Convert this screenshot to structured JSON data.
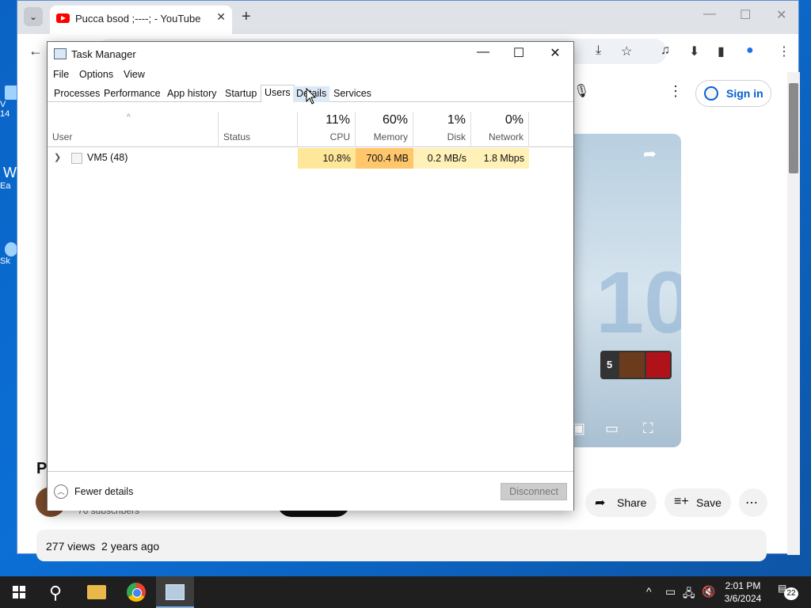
{
  "browser": {
    "tab_title": "Pucca bsod ;----; - YouTube",
    "signin_label": "Sign in",
    "views": "277 views",
    "age": "2 years ago",
    "subscribers": "76 subscribers",
    "share_label": "Share",
    "save_label": "Save",
    "page_title_fragment": "P",
    "playlist_count": "5"
  },
  "desktop": {
    "icons": [
      "V",
      "14",
      "W",
      "Ea",
      "Sk"
    ]
  },
  "task_manager": {
    "title": "Task Manager",
    "menu": [
      "File",
      "Options",
      "View"
    ],
    "tabs": [
      "Processes",
      "Performance",
      "App history",
      "Startup",
      "Users",
      "Details",
      "Services"
    ],
    "active_tab": "Users",
    "columns": {
      "user": "User",
      "status": "Status",
      "cpu": {
        "pct": "11%",
        "label": "CPU"
      },
      "memory": {
        "pct": "60%",
        "label": "Memory"
      },
      "disk": {
        "pct": "1%",
        "label": "Disk"
      },
      "network": {
        "pct": "0%",
        "label": "Network"
      }
    },
    "rows": [
      {
        "user": "VM5 (48)",
        "status": "",
        "cpu": "10.8%",
        "memory": "700.4 MB",
        "disk": "0.2 MB/s",
        "network": "1.8 Mbps"
      }
    ],
    "fewer_details": "Fewer details",
    "disconnect": "Disconnect"
  },
  "taskbar": {
    "time": "2:01 PM",
    "date": "3/6/2024",
    "notification_count": "22"
  },
  "colors": {
    "cpu_heat": "#ffe79a",
    "memory_heat": "#ffc66b",
    "disk_heat": "#fff1b8",
    "network_heat": "#fff1b8",
    "accent": "#0078d7"
  }
}
